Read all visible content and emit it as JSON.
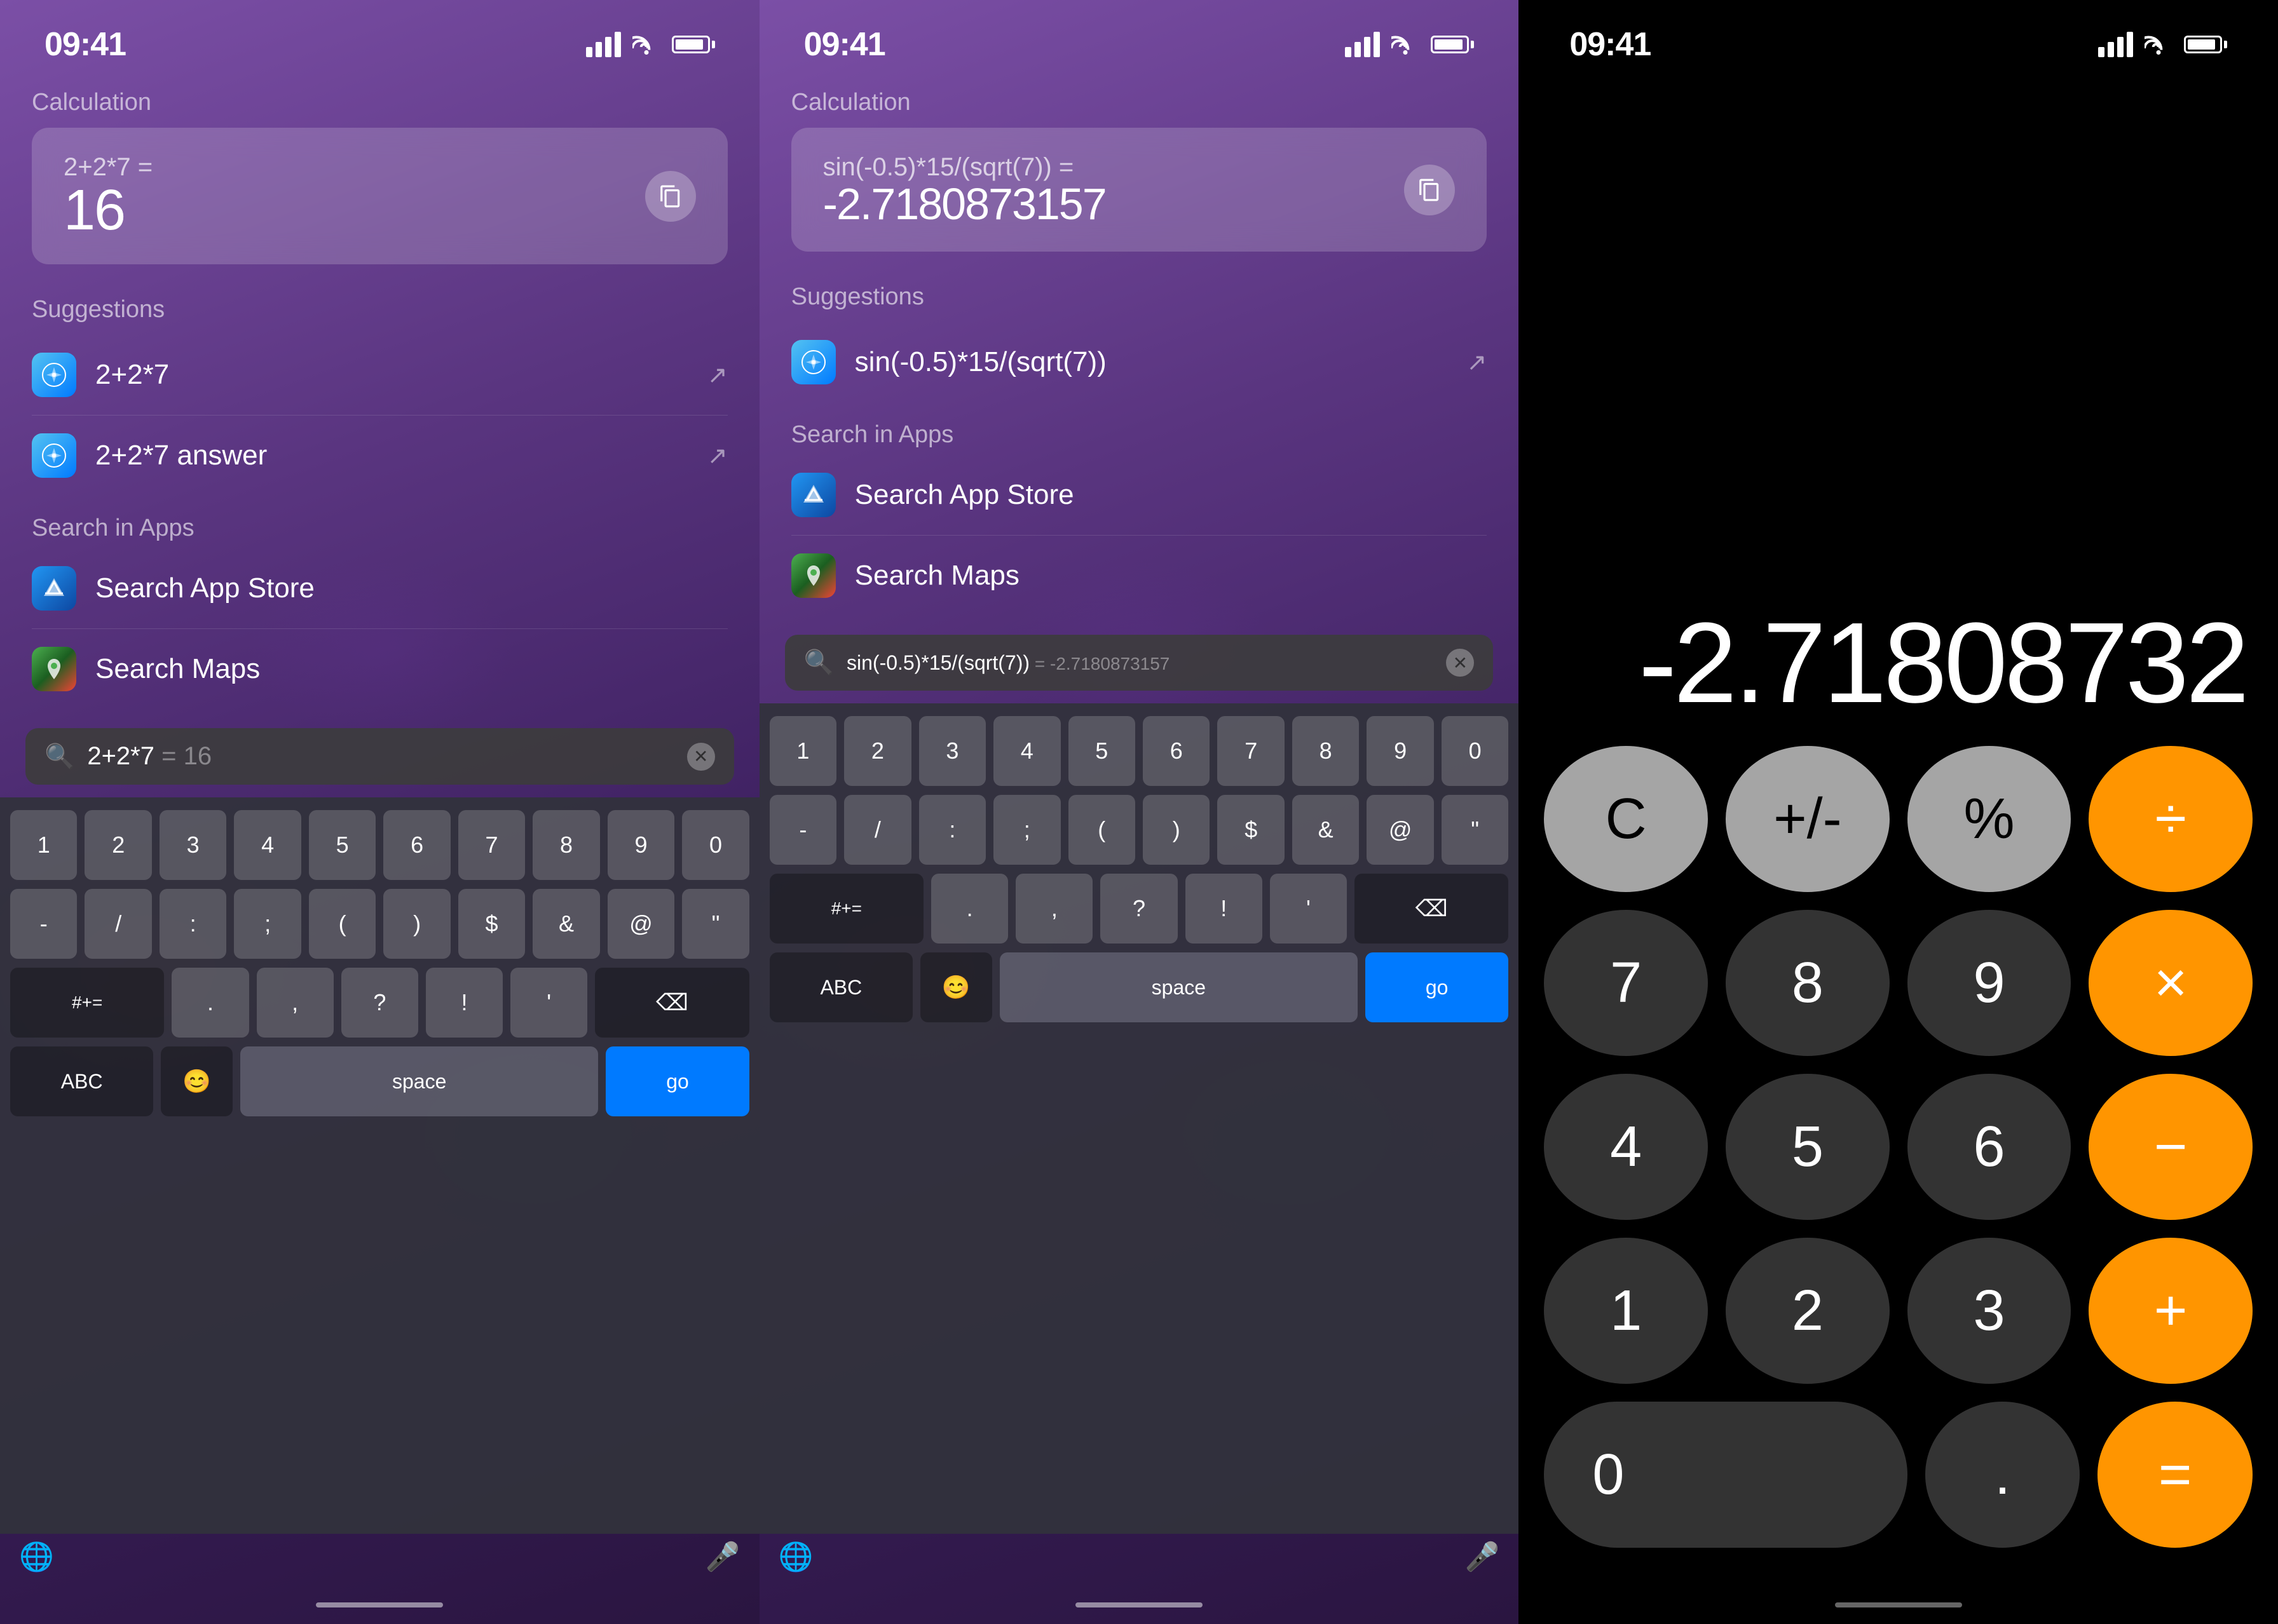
{
  "panel1": {
    "status": {
      "time": "09:41"
    },
    "calculation": {
      "label": "Calculation",
      "expression": "2+2*7 =",
      "result": "16"
    },
    "suggestions": {
      "label": "Suggestions",
      "items": [
        {
          "icon": "safari",
          "text": "2+2*7"
        },
        {
          "icon": "safari",
          "text": "2+2*7 answer"
        }
      ]
    },
    "searchInApps": {
      "label": "Search in Apps",
      "items": [
        {
          "icon": "appstore",
          "text": "Search App Store"
        },
        {
          "icon": "maps",
          "text": "Search Maps"
        }
      ]
    },
    "searchBar": {
      "query": "2+2*7",
      "ghost": " = 16"
    },
    "keyboard": {
      "rows": [
        [
          "1",
          "2",
          "3",
          "4",
          "5",
          "6",
          "7",
          "8",
          "9",
          "0"
        ],
        [
          "-",
          "/",
          ":",
          ";",
          "(",
          ")",
          "$",
          "&",
          "@",
          "\""
        ],
        [
          "#+=",
          ".",
          ",",
          "?",
          "!",
          "'",
          "⌫"
        ],
        [
          "ABC",
          "😊",
          "space",
          "go"
        ]
      ],
      "abc_label": "ABC",
      "emoji_label": "😊",
      "space_label": "space",
      "go_label": "go"
    }
  },
  "panel2": {
    "status": {
      "time": "09:41"
    },
    "calculation": {
      "label": "Calculation",
      "expression": "sin(-0.5)*15/(sqrt(7)) =",
      "result": "-2.7180873157"
    },
    "suggestions": {
      "label": "Suggestions",
      "items": [
        {
          "icon": "safari",
          "text": "sin(-0.5)*15/(sqrt(7))"
        }
      ]
    },
    "searchInApps": {
      "label": "Search in Apps",
      "items": [
        {
          "icon": "appstore",
          "text": "Search App Store"
        },
        {
          "icon": "maps",
          "text": "Search Maps"
        }
      ]
    },
    "searchBar": {
      "query": "sin(-0.5)*15/(sqrt(7))",
      "ghost": " = -2.7180873157"
    }
  },
  "panel3": {
    "status": {
      "time": "09:41"
    },
    "display": "-2.71808732",
    "buttons": {
      "row1": [
        "C",
        "+/-",
        "%",
        "÷"
      ],
      "row2": [
        "7",
        "8",
        "9",
        "×"
      ],
      "row3": [
        "4",
        "5",
        "6",
        "−"
      ],
      "row4": [
        "1",
        "2",
        "3",
        "+"
      ],
      "row5": [
        "0",
        ".",
        "="
      ]
    }
  }
}
